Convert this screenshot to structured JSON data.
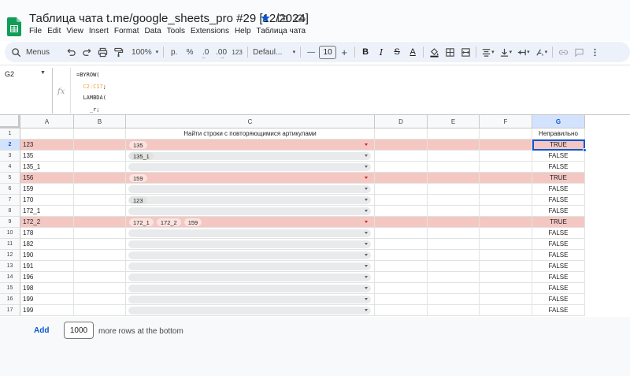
{
  "app": {
    "doc_title": "Таблица чата t.me/google_sheets_pro #29 [12/2024]",
    "menu": [
      "File",
      "Edit",
      "View",
      "Insert",
      "Format",
      "Data",
      "Tools",
      "Extensions",
      "Help",
      "Таблица чата"
    ]
  },
  "toolbar": {
    "search_label": "Menus",
    "zoom": "100%",
    "currency": "р.",
    "percent": "%",
    "decimal_decrease": ".0",
    "decimal_increase": ".00",
    "number_format": "123",
    "font_family": "Defaul...",
    "font_size": "10",
    "minus": "—",
    "plus": "+"
  },
  "formula_bar": {
    "name_box": "G2",
    "fx": "fx",
    "line1": "=BYROW(",
    "line2_range": "C2:C17",
    "line2_suffix": ";",
    "line3": "LAMBDA(",
    "line4": "_r;"
  },
  "grid": {
    "columns": [
      "A",
      "B",
      "C",
      "D",
      "E",
      "F",
      "G"
    ],
    "header_row": {
      "num": "1",
      "c": "Найти строки с повторяющимися артикулами",
      "g": "Неправильно"
    },
    "rows": [
      {
        "num": "2",
        "a": "123",
        "chips": [
          "135"
        ],
        "g": "TRUE",
        "hl": true
      },
      {
        "num": "3",
        "a": "135",
        "chips": [
          "135_1"
        ],
        "g": "FALSE",
        "hl": false
      },
      {
        "num": "4",
        "a": "135_1",
        "chips": [],
        "g": "FALSE",
        "hl": false
      },
      {
        "num": "5",
        "a": "156",
        "chips": [
          "159"
        ],
        "g": "TRUE",
        "hl": true
      },
      {
        "num": "6",
        "a": "159",
        "chips": [],
        "g": "FALSE",
        "hl": false
      },
      {
        "num": "7",
        "a": "170",
        "chips": [
          "123"
        ],
        "g": "FALSE",
        "hl": false
      },
      {
        "num": "8",
        "a": "172_1",
        "chips": [],
        "g": "FALSE",
        "hl": false
      },
      {
        "num": "9",
        "a": "172_2",
        "chips": [
          "172_1",
          "172_2",
          "159"
        ],
        "g": "TRUE",
        "hl": true
      },
      {
        "num": "10",
        "a": "178",
        "chips": [],
        "g": "FALSE",
        "hl": false
      },
      {
        "num": "11",
        "a": "182",
        "chips": [],
        "g": "FALSE",
        "hl": false
      },
      {
        "num": "12",
        "a": "190",
        "chips": [],
        "g": "FALSE",
        "hl": false
      },
      {
        "num": "13",
        "a": "191",
        "chips": [],
        "g": "FALSE",
        "hl": false
      },
      {
        "num": "14",
        "a": "196",
        "chips": [],
        "g": "FALSE",
        "hl": false
      },
      {
        "num": "15",
        "a": "198",
        "chips": [],
        "g": "FALSE",
        "hl": false
      },
      {
        "num": "16",
        "a": "199",
        "chips": [],
        "g": "FALSE",
        "hl": false
      },
      {
        "num": "17",
        "a": "199",
        "chips": [],
        "g": "FALSE",
        "hl": false
      }
    ]
  },
  "bottom": {
    "add_label": "Add",
    "rows_value": "1000",
    "more_text": "more rows at the bottom"
  },
  "colors": {
    "highlight": "#f4c7c3",
    "selection": "#0b57d0",
    "sheets_green": "#0f9d58"
  }
}
